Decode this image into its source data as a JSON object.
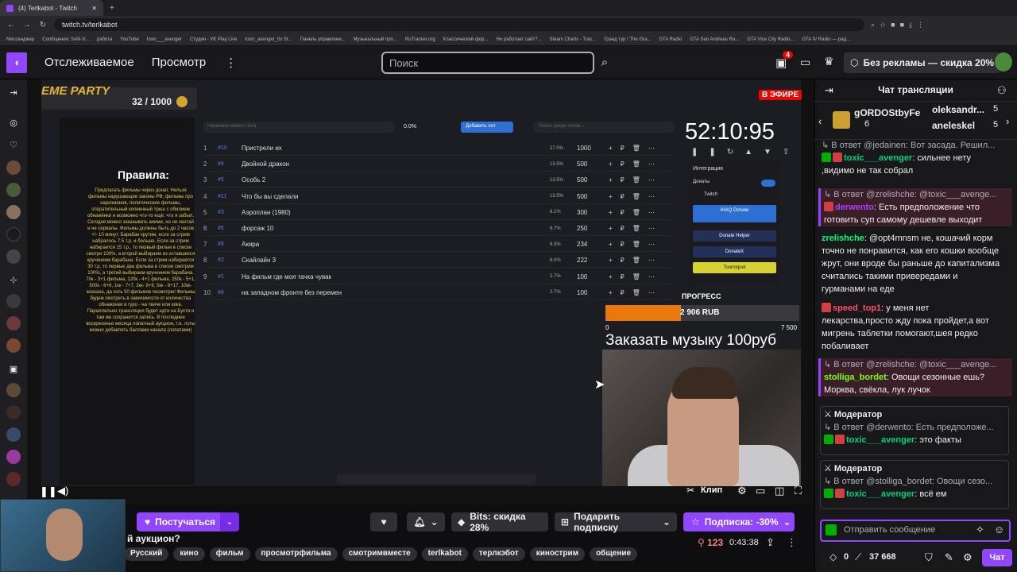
{
  "browser": {
    "tab_title": "(4) Terlkabot - Twitch",
    "url": "twitch.tv/terlkabot",
    "bookmarks": [
      "Мессенджер",
      "Сообщения: SAN-V...",
      "работа",
      "YouTube",
      "toxic___avenger",
      "Студия - VK Play Live",
      "toxic_avenger_ttv St...",
      "Панель управлени...",
      "Музыкальный про...",
      "RuTracker.org",
      "Классический фор...",
      "Не работает сайт?...",
      "Steam Charts - Trac...",
      "Гранд тур / The Gra...",
      "GTA Radio",
      "GTA San Andreas Ra...",
      "GTA Vice City Radio...",
      "GTA IV Radio — рад..."
    ]
  },
  "topnav": {
    "following": "Отслеживаемое",
    "browse": "Просмотр",
    "search_placeholder": "Поиск",
    "notif_count": "4",
    "noads": "Без рекламы — скидка 20%"
  },
  "stream_overlay": {
    "theme": "EME PARTY",
    "counter": "32 / 1000",
    "live_badge": "В ЭФИРЕ",
    "rules_title": "Правила:",
    "rules_text": "Предлагать фильмы через донат. Нельзя фильмы нарушающие законы РФ, фильмы про наркоманов, политические фильмы, отвратительный копеечный треш с обилием обнажёнки и возможно что-то ещё, что я забыл. Сегодня можно заказывать аниме, но не хентай и не сериалы. Фильмы должны быть до 2 часов +/- 10 минут. Барабан крутим, если за стрим набралось 7.5 т.р. и больше. Если за стрим набирается 15 т.р., то первый фильм в списке смотри 100%, а второй выбираем из оставшихся кручением барабана. Если за стрим набирается 30 т.р, то первые два фильма в списке смотрим 100%, а третий выбираем кручением барабана. 70к - 3+1 фильма, 120к - 4+1 фильма, 250к - 5+1, 500к - 6+6, 1кк - 7+7, 2кк- 8+8, 5кк - 8+17, 10кк-ахахаха, да хоть 50 фильмов посмотрю! Фильмы будем смотреть в зависимости от количества обнажонки и гуро - на твиче или кике. Параллельно трансляция будет идти на Бусти и там же сохранится запись. В последнее воскресенье месяца лопатный аукцион, т.е. лоты можно добавлять баллами канала (лопатами)",
    "lot_placeholder": "Название нового лота",
    "lot_pct": "0.0%",
    "add_lot": "Добавить лот",
    "lot_search": "Поиск среди лотов...",
    "lots": [
      {
        "n": "1",
        "tag": "#10",
        "name": "Пристрели их",
        "pct": "27.0%",
        "val": "1000"
      },
      {
        "n": "2",
        "tag": "#4",
        "name": "Двойной дракон",
        "pct": "13.5%",
        "val": "500"
      },
      {
        "n": "3",
        "tag": "#5",
        "name": "Особь 2",
        "pct": "13.5%",
        "val": "500"
      },
      {
        "n": "4",
        "tag": "#11",
        "name": "Что бы вы сделали",
        "pct": "13.5%",
        "val": "500"
      },
      {
        "n": "5",
        "tag": "#3",
        "name": "Аэроплан (1980)",
        "pct": "8.1%",
        "val": "300"
      },
      {
        "n": "6",
        "tag": "#6",
        "name": "форсаж 10",
        "pct": "6.7%",
        "val": "250"
      },
      {
        "n": "7",
        "tag": "#8",
        "name": "Акира",
        "pct": "6.3%",
        "val": "234"
      },
      {
        "n": "8",
        "tag": "#2",
        "name": "Скайлайн 3",
        "pct": "6.0%",
        "val": "222"
      },
      {
        "n": "9",
        "tag": "#1",
        "name": "На фильм где моя тачка чувак",
        "pct": "2.7%",
        "val": "100"
      },
      {
        "n": "10",
        "tag": "#9",
        "name": "на западном фронте без перемен",
        "pct": "2.7%",
        "val": "100"
      }
    ],
    "timer": "52:10:95",
    "integrations": "Интеграция",
    "donations": "Донаты",
    "twitch": "Twitch",
    "btn_ihaq": "IHAQ Donate",
    "btn_donate_helper": "Donate Helper",
    "btn_donatex": "DonateX",
    "btn_tourniquet": "Tourniquet",
    "progress_label": "ПРОГРЕСС",
    "progress_amount": "2 906 RUB",
    "progress_min": "0",
    "progress_max": "7 500",
    "progress_fraction": 0.39,
    "order_music": "Заказать музыку 100руб"
  },
  "player": {
    "clip": "Клип"
  },
  "below": {
    "follow": "Постучаться",
    "bits": "Bits: скидка 28%",
    "gift": "Подарить подписку",
    "subscribe": "Подписка: -30%",
    "title": "й аукцион?",
    "tags": [
      "Русский",
      "кино",
      "фильм",
      "просмотрфильма",
      "смотримвместе",
      "terlkabot",
      "терлкэбот",
      "кинострим",
      "общение"
    ],
    "viewers": "123",
    "uptime": "0:43:38"
  },
  "chat": {
    "header": "Чат трансляции",
    "gifts": [
      {
        "name": "gORDOStbyFe",
        "count": "6"
      },
      {
        "name": "oleksandr...",
        "count": "5"
      },
      {
        "name": "aneleskel",
        "count": "5"
      }
    ],
    "messages": [
      {
        "reply": "В ответ @jedainen: Вот засада. Решил...",
        "user": "toxic___avenger",
        "text": "сильнее нету ,видимо не так собрал",
        "color": "#00d37c"
      },
      {
        "reply": "В ответ @zrelishche: @toxic___avenge...",
        "user": "derwento",
        "text": "Есть предположение что готовить суп самому дешевле выходит",
        "color": "#b43cff"
      },
      {
        "reply": "",
        "user": "zrelishche",
        "text": "@opt4mnsm не, кошачий корм точно не понравится, как его кошки вообще жрут, они вроде бы раньше до капитализма считались такими привередами и гурманами на еде",
        "color": "#00ff7f"
      },
      {
        "reply": "",
        "user": "speed_top1",
        "text": "у меня нет лекарства,просто жду пока пройдет,а вот мигрень таблетки помогают,шея редко побаливает",
        "color": "#ff4f6d"
      },
      {
        "reply": "В ответ @zrelishche: @toxic___avenge...",
        "user": "stolliga_bordet",
        "text": "Овощи сезонные ешь? Морква, свёкла, лук лучок",
        "color": "#7fff00"
      }
    ],
    "mod_label": "Модератор",
    "mod_msgs": [
      {
        "reply": "В ответ @derwento: Есть предположе...",
        "user": "toxic___avenger",
        "text": "это факты"
      },
      {
        "reply": "В ответ @stolliga_bordet: Овощи сезо...",
        "user": "toxic___avenger",
        "text": "всё ем"
      }
    ],
    "input_placeholder": "Отправить сообщение",
    "points": "0",
    "points2": "37 668",
    "chat_btn": "Чат"
  }
}
